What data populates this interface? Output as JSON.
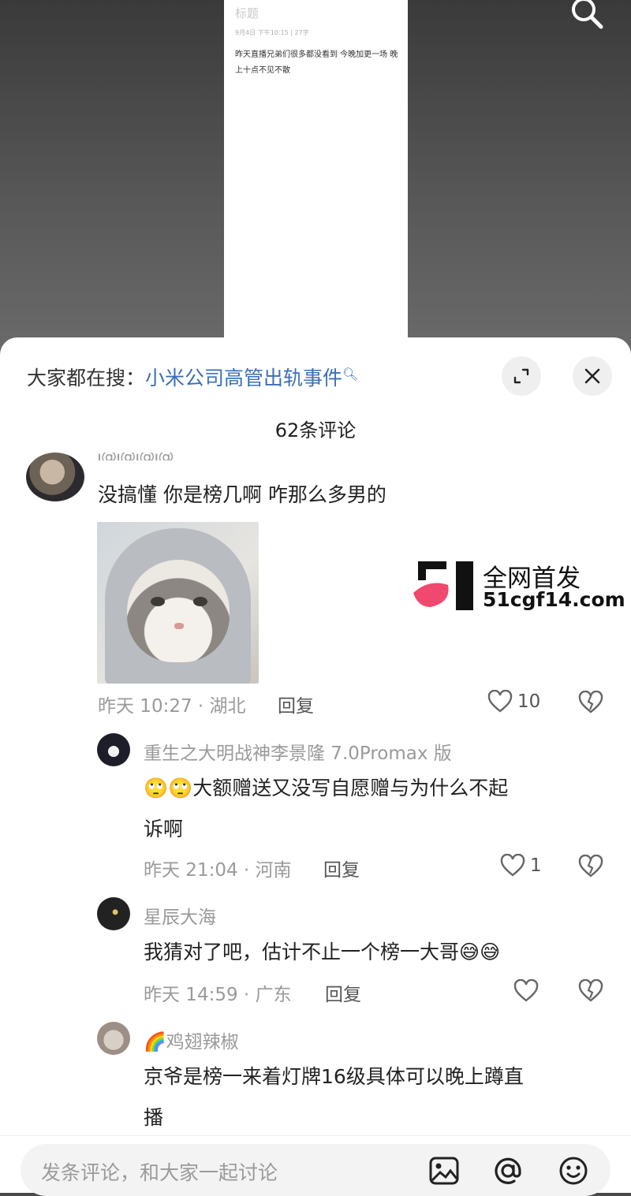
{
  "note": {
    "title": "标题",
    "meta": "9月4日 下午10:15 | 27字",
    "body": "昨天直播兄弟们很多都没看到 今晚加更一场 晚上十点不见不散"
  },
  "sheet": {
    "search_prefix": "大家都在搜：",
    "search_term": "小米公司高管出轨事件",
    "comment_count": "62条评论"
  },
  "comments": {
    "main": {
      "name_cut": "Ꭵ@Ꭵ@Ꭵ@Ꭵ@",
      "text": "没搞懂 你是榜几啊 咋那么多男的",
      "meta": "昨天 10:27 · 湖北",
      "reply": "回复",
      "likes": "10"
    },
    "replies": [
      {
        "name": "重生之大明战神李景隆 7.0Promax 版",
        "text_line1": "🙄🙄大额赠送又没写自愿赠与为什么不起",
        "text_line2": "诉啊",
        "meta": "昨天 21:04 · 河南",
        "reply": "回复",
        "likes": "1"
      },
      {
        "name": "星辰大海",
        "text": "我猜对了吧，估计不止一个榜一大哥😅😅",
        "meta": "昨天 14:59 · 广东",
        "reply": "回复",
        "likes": ""
      },
      {
        "name": "🌈鸡翅辣椒",
        "text_line1": "京爷是榜一来着灯牌16级具体可以晚上蹲直",
        "text_line2": "播"
      }
    ]
  },
  "watermark": {
    "line1": "全网首发",
    "line2": "51cgf14.com"
  },
  "input": {
    "placeholder": "发条评论，和大家一起讨论"
  },
  "colors": {
    "link": "#3b6fb6",
    "logo_pink": "#f0486e"
  }
}
